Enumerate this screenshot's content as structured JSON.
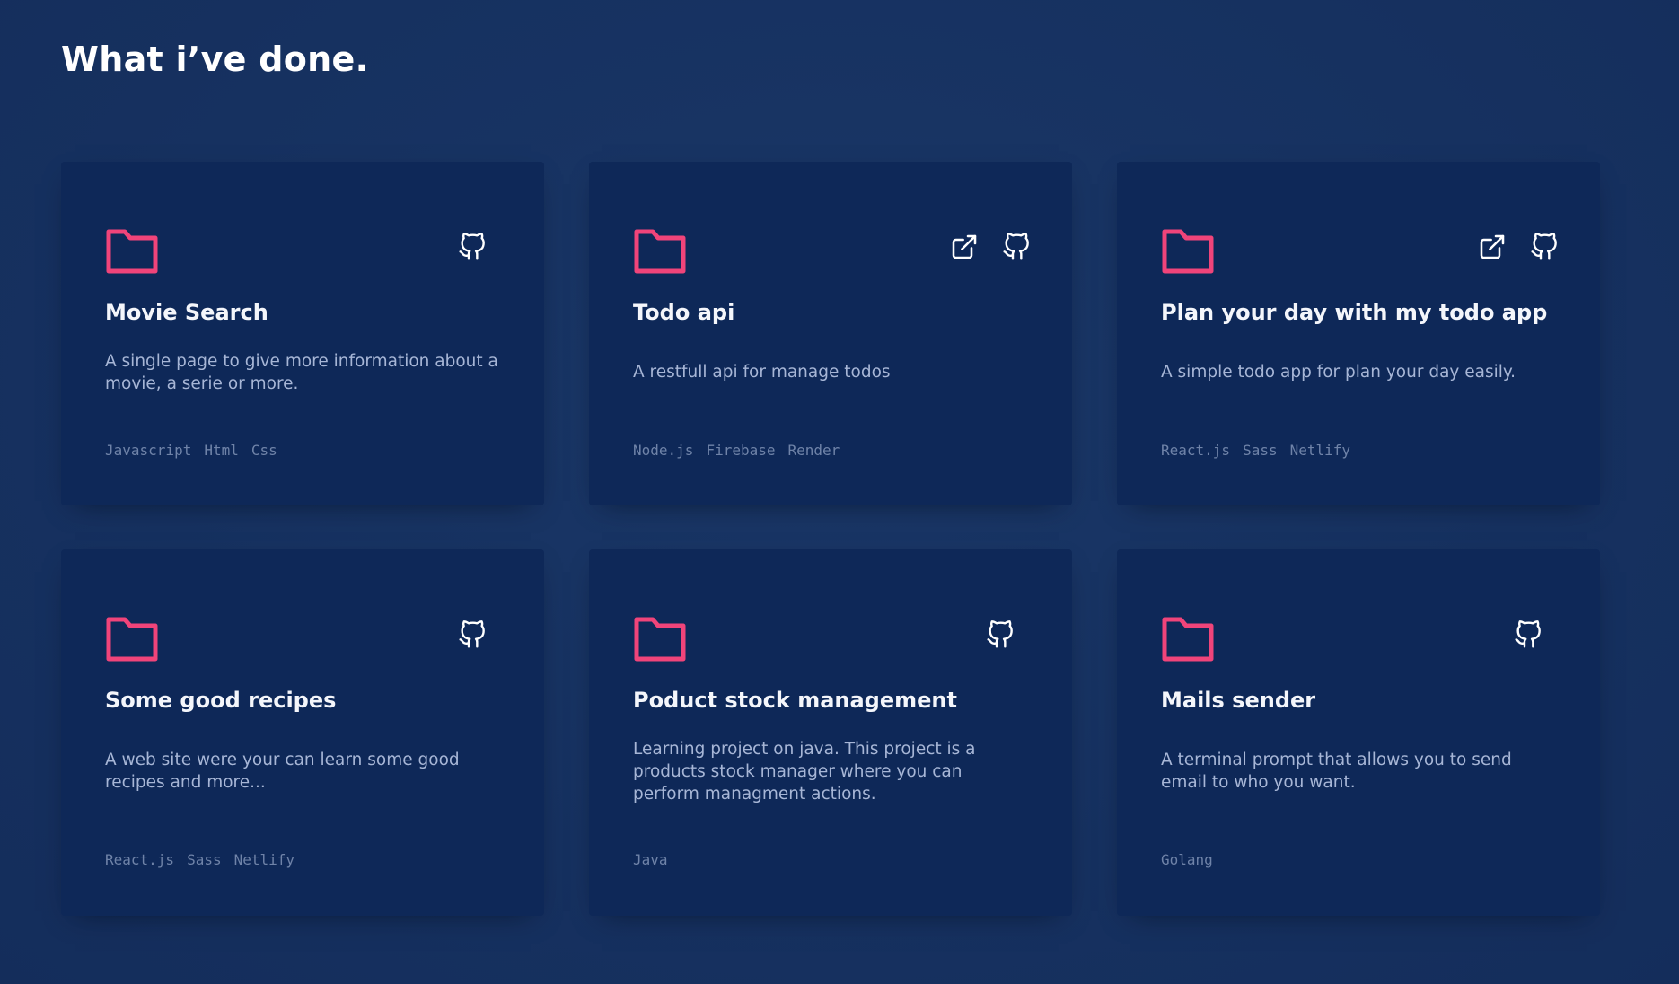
{
  "section": {
    "title": "What i’ve done."
  },
  "colors": {
    "background": "#173362",
    "card": "#0e2858",
    "accent": "#f0447a",
    "title": "#f4f6fb",
    "description": "#a7b6d6",
    "tags": "#6f83a8"
  },
  "projects": [
    {
      "title": "Movie Search",
      "description": "A single page to give more information about a movie, a serie or more.",
      "tags": [
        "Javascript",
        "Html",
        "Css"
      ],
      "icons": [
        "folder-icon",
        "github-icon"
      ]
    },
    {
      "title": "Todo api",
      "description": "A restfull api for manage todos",
      "tags": [
        "Node.js",
        "Firebase",
        "Render"
      ],
      "icons": [
        "folder-icon",
        "external-link-icon",
        "github-icon"
      ]
    },
    {
      "title": "Plan your day with my todo app",
      "description": "A simple todo app for plan your day easily.",
      "tags": [
        "React.js",
        "Sass",
        "Netlify"
      ],
      "icons": [
        "folder-icon",
        "external-link-icon",
        "github-icon"
      ]
    },
    {
      "title": "Some good recipes",
      "description": "A web site were your can learn some good recipes and more...",
      "tags": [
        "React.js",
        "Sass",
        "Netlify"
      ],
      "icons": [
        "folder-icon",
        "github-icon"
      ]
    },
    {
      "title": "Poduct stock management",
      "description": "Learning project on java. This project is a products stock manager where you can perform managment actions.",
      "tags": [
        "Java"
      ],
      "icons": [
        "folder-icon",
        "github-icon"
      ]
    },
    {
      "title": "Mails sender",
      "description": "A terminal prompt that allows you to send email to who you want.",
      "tags": [
        "Golang"
      ],
      "icons": [
        "folder-icon",
        "github-icon"
      ]
    }
  ]
}
